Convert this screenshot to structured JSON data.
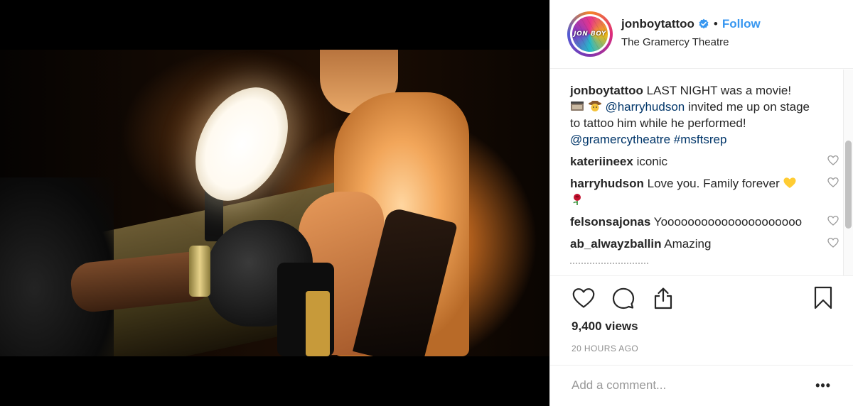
{
  "post": {
    "username": "jonboytattoo",
    "follow_label": "Follow",
    "separator": "•",
    "location": "The Gramercy Theatre",
    "avatar_text": "JON BOY",
    "caption": {
      "author": "jonboytattoo",
      "text_1": " LAST NIGHT was a movie!",
      "mention_1": "@harryhudson",
      "text_2": " invited me up on stage to tattoo him while he performed! ",
      "mention_2": "@gramercytheatre",
      "hashtag": "#msftsrep"
    },
    "comments": [
      {
        "author": "kateriineex",
        "text": " iconic"
      },
      {
        "author": "harryhudson",
        "text": " Love you. Family forever "
      },
      {
        "author": "felsonsajonas",
        "text": " Yooooooooooooooooooooo"
      },
      {
        "author": "ab_alwayzballin",
        "text": " Amazing"
      }
    ],
    "views": "9,400 views",
    "timestamp": "20 HOURS AGO",
    "add_comment_placeholder": "Add a comment...",
    "more_label": "•••"
  },
  "icons": {
    "verified": "verified-badge-icon",
    "like": "heart-icon",
    "comment": "comment-bubble-icon",
    "share": "share-icon",
    "save": "bookmark-icon",
    "comment_like": "heart-outline-icon"
  },
  "colors": {
    "link_blue": "#3897f0",
    "mention_blue": "#003569",
    "text": "#262626",
    "muted": "#8e8e8e",
    "border": "#efefef"
  }
}
